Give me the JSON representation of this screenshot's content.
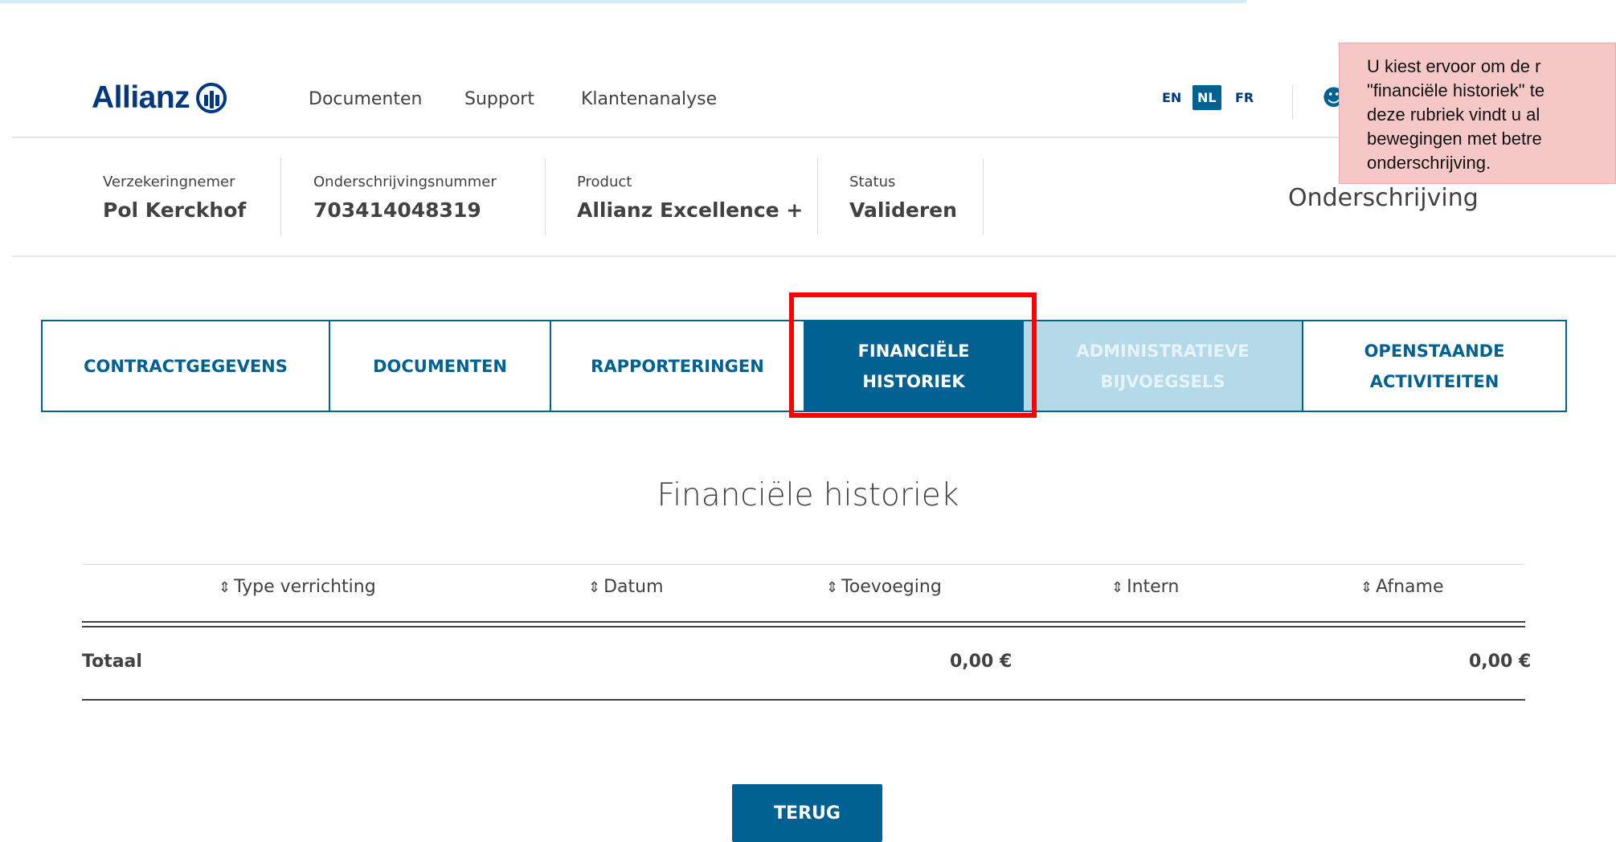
{
  "header": {
    "logo_text": "Allianz",
    "nav": [
      "Documenten",
      "Support",
      "Klantenanalyse"
    ],
    "languages": [
      "EN",
      "NL",
      "FR"
    ],
    "active_language": "NL"
  },
  "info": {
    "policyholder_label": "Verzekeringnemer",
    "policyholder_value": "Pol Kerckhof",
    "number_label": "Onderschrijvingsnummer",
    "number_value": "703414048319",
    "product_label": "Product",
    "product_value": "Allianz Excellence +",
    "status_label": "Status",
    "status_value": "Valideren",
    "page_title": "Onderschrijving"
  },
  "tooltip": {
    "text": "U kiest ervoor om de r\n\"financiële historiek\" te\ndeze rubriek vindt u al\nbewegingen met betre\nonderschrijving."
  },
  "tabs": [
    {
      "line1": "CONTRACTGEGEVENS",
      "line2": ""
    },
    {
      "line1": "DOCUMENTEN",
      "line2": ""
    },
    {
      "line1": "RAPPORTERINGEN",
      "line2": ""
    },
    {
      "line1": "FINANCIËLE",
      "line2": "HISTORIEK"
    },
    {
      "line1": "ADMINISTRATIEVE",
      "line2": "BIJVOEGSELS"
    },
    {
      "line1": "OPENSTAANDE",
      "line2": "ACTIVITEITEN"
    }
  ],
  "section_title": "Financiële historiek",
  "table": {
    "headers": [
      "Type verrichting",
      "Datum",
      "Toevoeging",
      "Intern",
      "Afname"
    ],
    "total_label": "Totaal",
    "total_toevoeging": "0,00 €",
    "total_afname": "0,00 €"
  },
  "back_button": "TERUG",
  "colors": {
    "brand": "#003781",
    "accent": "#006192",
    "highlight": "#ff0000",
    "tooltip_bg": "#f6c7c7"
  }
}
